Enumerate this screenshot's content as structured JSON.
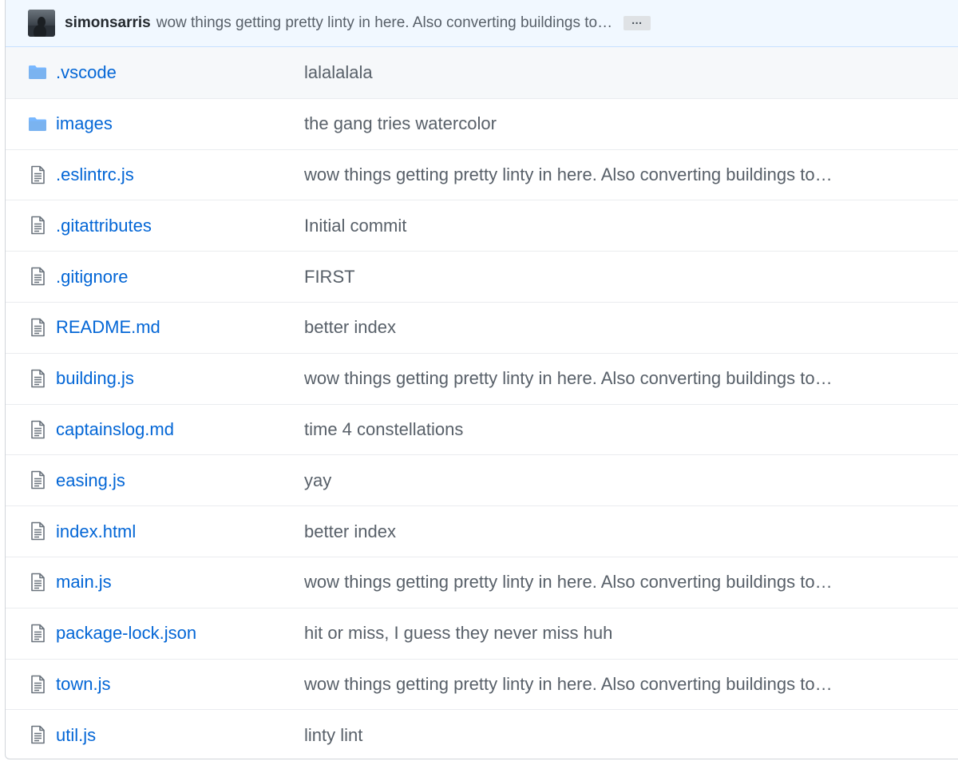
{
  "commit": {
    "author": "simonsarris",
    "message": "wow things getting pretty linty in here. Also converting buildings to…",
    "expand_label": "…"
  },
  "files": [
    {
      "type": "folder",
      "name": ".vscode",
      "message": "lalalalala"
    },
    {
      "type": "folder",
      "name": "images",
      "message": "the gang tries watercolor"
    },
    {
      "type": "file",
      "name": ".eslintrc.js",
      "message": "wow things getting pretty linty in here. Also converting buildings to…"
    },
    {
      "type": "file",
      "name": ".gitattributes",
      "message": "Initial commit"
    },
    {
      "type": "file",
      "name": ".gitignore",
      "message": "FIRST"
    },
    {
      "type": "file",
      "name": "README.md",
      "message": "better index"
    },
    {
      "type": "file",
      "name": "building.js",
      "message": "wow things getting pretty linty in here. Also converting buildings to…"
    },
    {
      "type": "file",
      "name": "captainslog.md",
      "message": "time 4 constellations"
    },
    {
      "type": "file",
      "name": "easing.js",
      "message": "yay"
    },
    {
      "type": "file",
      "name": "index.html",
      "message": "better index"
    },
    {
      "type": "file",
      "name": "main.js",
      "message": "wow things getting pretty linty in here. Also converting buildings to…"
    },
    {
      "type": "file",
      "name": "package-lock.json",
      "message": "hit or miss, I guess they never miss huh"
    },
    {
      "type": "file",
      "name": "town.js",
      "message": "wow things getting pretty linty in here. Also converting buildings to…"
    },
    {
      "type": "file",
      "name": "util.js",
      "message": "linty lint"
    }
  ],
  "colors": {
    "link": "#0366d6",
    "muted": "#586069",
    "folder_icon": "#79b8ff",
    "file_icon": "#6a737d",
    "commit_bar_bg": "#f1f8ff"
  },
  "icons": {
    "folder": "folder-icon",
    "file": "file-text-icon"
  }
}
